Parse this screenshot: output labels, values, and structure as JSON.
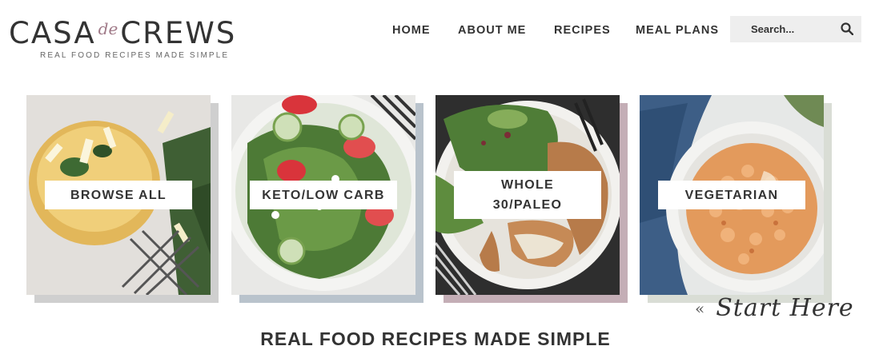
{
  "header": {
    "logo": {
      "left": "CASA",
      "mid": "de",
      "right": "CREWS",
      "tagline": "REAL FOOD RECIPES MADE SIMPLE"
    },
    "nav": [
      "HOME",
      "ABOUT ME",
      "RECIPES",
      "MEAL PLANS"
    ],
    "search": {
      "placeholder": "Search...",
      "icon": "search-icon"
    }
  },
  "categories": [
    {
      "label": "BROWSE ALL",
      "shadow_color": "#cfcfcf"
    },
    {
      "label": "KETO/LOW CARB",
      "shadow_color": "#b9c3cc"
    },
    {
      "label_line1": "WHOLE",
      "label_line2": "30/PALEO",
      "shadow_color": "#c4aeb6"
    },
    {
      "label": "VEGETARIAN",
      "shadow_color": "#d9ddd5"
    }
  ],
  "start_here": {
    "chevron": "«",
    "text": "Start Here"
  },
  "tagline": "REAL FOOD RECIPES MADE SIMPLE",
  "colors": {
    "text": "#333333",
    "logo_accent": "#a07a88",
    "search_bg": "#eeeeee"
  }
}
